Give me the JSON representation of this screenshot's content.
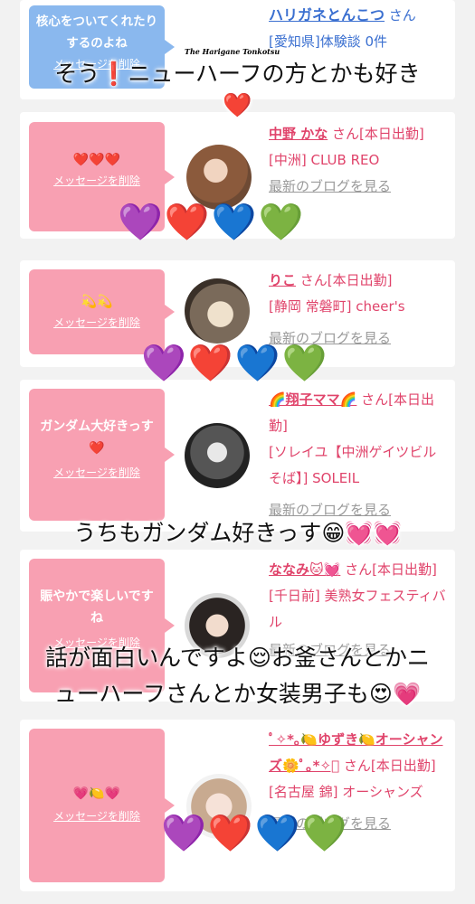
{
  "cards": [
    {
      "message": "核心をついてくれたりするのよね",
      "delete_label": "メッセージを削除",
      "name": "ハリガネとんこつ",
      "san": "さん",
      "detail": "[愛知県]体験談 0件",
      "blog": ""
    },
    {
      "message": "❤️❤️❤️",
      "delete_label": "メッセージを削除",
      "name": "中野 かな",
      "san": "さん[本日出勤]",
      "detail": "[中洲] CLUB REO",
      "blog": "最新のブログを見る"
    },
    {
      "message": "💫💫",
      "delete_label": "メッセージを削除",
      "name": "りこ",
      "san": "さん[本日出勤]",
      "detail": "[静岡 常磐町] cheer's",
      "blog": "最新のブログを見る"
    },
    {
      "message": "ガンダム大好きっす❤️",
      "delete_label": "メッセージを削除",
      "name": "🌈翔子ママ🌈",
      "san": "さん[本日出勤]",
      "detail": "[ソレイユ【中洲ゲイツビルそば】] SOLEIL",
      "blog": "最新のブログを見る"
    },
    {
      "message": "賑やかで楽しいですね",
      "delete_label": "メッセージを削除",
      "name": "ななみ🐱💓",
      "san": "さん[本日出勤]",
      "detail": "[千日前] 美熟女フェスティバル",
      "blog": "最新のブログを見る"
    },
    {
      "message": "💗🍋💗",
      "delete_label": "メッセージを削除",
      "name": "ﾟ✧*｡🍋ゆずき🍋オーシャンズ🌼ﾟ｡*✧ﾟ",
      "san": "さん[本日出勤]",
      "detail": "[名古屋 錦] オーシャンズ",
      "blog": "最新のブログを見る"
    }
  ],
  "logo_text": "The Harigane Tonkotsu",
  "overlays": {
    "t1": "そう❗ニューハーフの方とかも好き",
    "t2": "❤️",
    "t3": "うちもガンダム好きっす😁💓💓",
    "t4": "話が面白いんですよ😌お釜さんとかニ",
    "t5": "ューハーフさんとか女装男子も😍💗"
  },
  "heart_rows": [
    [
      "💜",
      "❤️",
      "💙",
      "💚"
    ],
    [
      "💜",
      "❤️",
      "💙",
      "💚"
    ],
    [
      "💜",
      "❤️",
      "💙",
      "💚"
    ]
  ]
}
